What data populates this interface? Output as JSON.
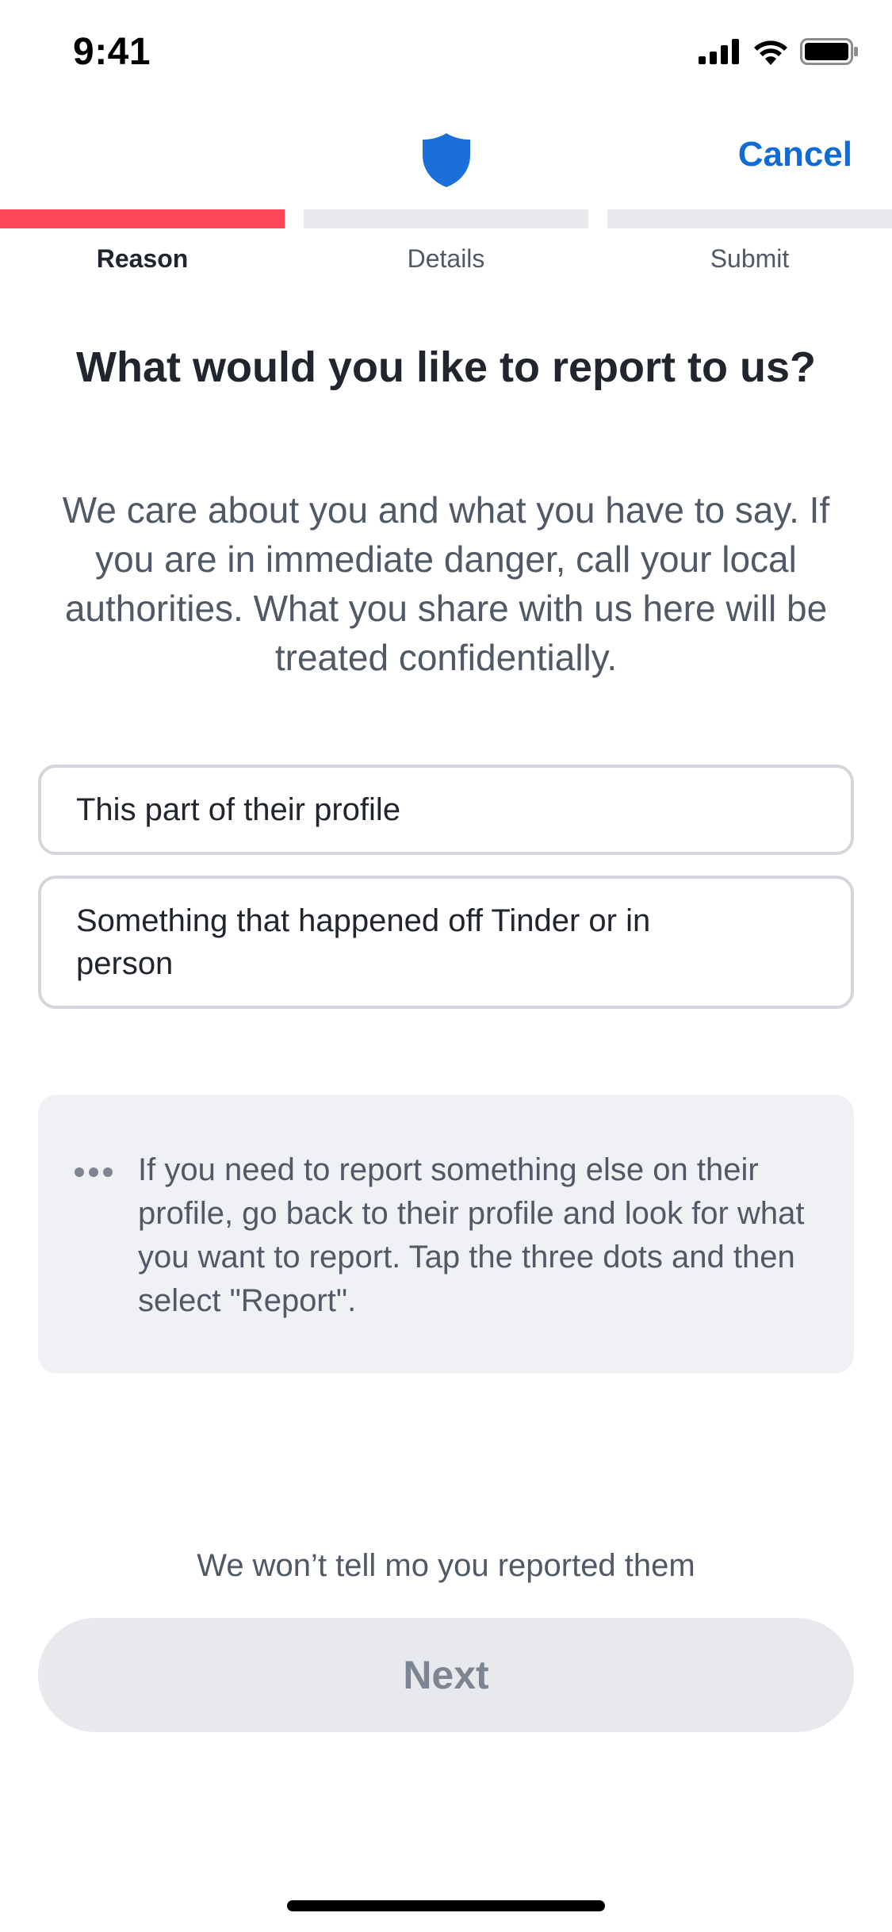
{
  "status_bar": {
    "time": "9:41",
    "icons": [
      "cellular-signal-icon",
      "wifi-icon",
      "battery-icon"
    ]
  },
  "header": {
    "logo_icon": "shield-icon",
    "cancel_label": "Cancel"
  },
  "steps": [
    {
      "label": "Reason",
      "active": true
    },
    {
      "label": "Details",
      "active": false
    },
    {
      "label": "Submit",
      "active": false
    }
  ],
  "title": "What would you like to report to us?",
  "description": "We care about you and what you have to say. If you are in immediate danger, call your local authorities. What you share with us here will be treated confidentially.",
  "options": [
    {
      "label": "This part of their profile"
    },
    {
      "label": "Something that happened off Tinder or in person"
    }
  ],
  "info": {
    "icon": "more-dots-icon",
    "text": "If you need to report something else on their profile, go back to their profile and look for what you want to report. Tap the three dots and then select \"Report\"."
  },
  "notice": "We won’t tell mo you reported them",
  "next_button_label": "Next",
  "colors": {
    "accent_red": "#fd4658",
    "link_blue": "#106bd5",
    "shield_blue": "#1b6fd8",
    "disabled_bg": "#e8e9ec",
    "disabled_text": "#7c8591"
  }
}
